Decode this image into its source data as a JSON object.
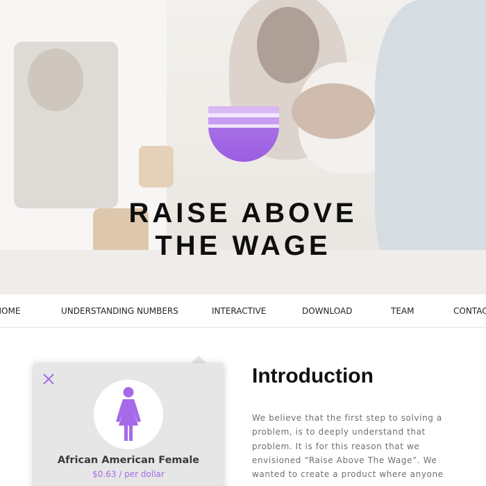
{
  "hero": {
    "title_line1": "RAISE ABOVE",
    "title_line2": "THE WAGE",
    "logo": "half-circle-striped-logo"
  },
  "nav": {
    "items": [
      {
        "label": "HOME"
      },
      {
        "label": "UNDERSTANDING NUMBERS"
      },
      {
        "label": "INTERACTIVE"
      },
      {
        "label": "DOWNLOAD"
      },
      {
        "label": "TEAM"
      },
      {
        "label": "CONTACT"
      }
    ]
  },
  "card": {
    "close_icon": "close-icon",
    "figure_icon": "female-figure-icon",
    "name": "African American Female",
    "wage": "$0.63 / per dollar"
  },
  "intro": {
    "title": "Introduction",
    "lines": [
      "We believe that the first step to solving a",
      "problem, is to deeply understand that",
      "problem. It is for this reason that we",
      "envisioned “Raise Above The Wage”. We",
      "wanted to create a product where anyone"
    ]
  },
  "colors": {
    "accent": "#a66ae8",
    "logo_purple": "#9a5de2",
    "text_dark": "#111111",
    "text_body": "#6f6f6f"
  }
}
